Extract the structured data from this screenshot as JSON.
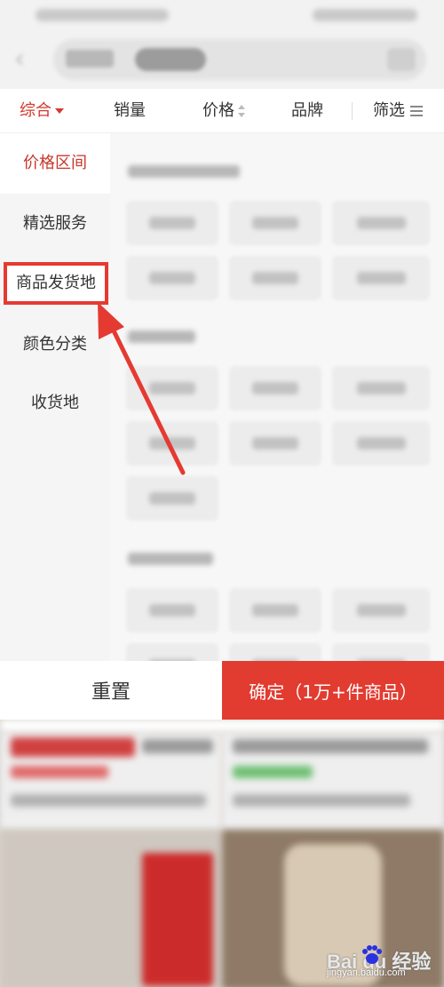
{
  "sort_tabs": {
    "comprehensive": "综合",
    "sales": "销量",
    "price": "价格",
    "brand": "品牌",
    "filter": "筛选"
  },
  "filter_categories": [
    {
      "label": "价格区间",
      "state": "active"
    },
    {
      "label": "精选服务",
      "state": "normal"
    },
    {
      "label": "商品发货地",
      "state": "highlighted"
    },
    {
      "label": "颜色分类",
      "state": "normal"
    },
    {
      "label": "收货地",
      "state": "normal"
    }
  ],
  "actions": {
    "reset_label": "重置",
    "confirm_label": "确定（1万+件商品）"
  },
  "watermark": {
    "brand": "Bai du 经验",
    "url": "jingyan.baidu.com"
  },
  "colors": {
    "accent_red": "#e23b30",
    "active_text": "#c8362b",
    "annotation": "#e53a32"
  }
}
